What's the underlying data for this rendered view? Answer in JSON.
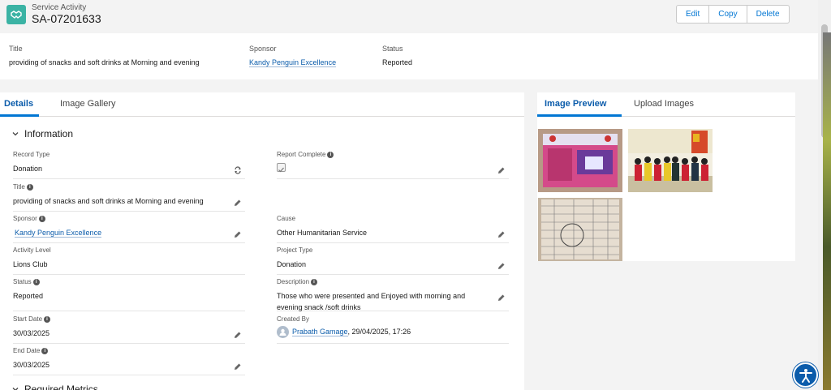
{
  "header": {
    "object_type": "Service Activity",
    "record_name": "SA-07201633",
    "buttons": {
      "edit": "Edit",
      "copy": "Copy",
      "delete": "Delete"
    }
  },
  "highlights": {
    "title_label": "Title",
    "title_value": "providing of snacks and soft drinks at Morning and evening",
    "sponsor_label": "Sponsor",
    "sponsor_value": "Kandy Penguin Excellence",
    "status_label": "Status",
    "status_value": "Reported"
  },
  "tabs": {
    "details": "Details",
    "image_gallery": "Image Gallery"
  },
  "section": {
    "information": "Information",
    "required_metrics": "Required Metrics"
  },
  "fields": {
    "record_type": {
      "label": "Record Type",
      "value": "Donation"
    },
    "report_complete": {
      "label": "Report Complete",
      "checked": true
    },
    "title": {
      "label": "Title",
      "value": "providing of snacks and soft drinks at Morning and evening"
    },
    "sponsor": {
      "label": "Sponsor",
      "value": "Kandy Penguin Excellence"
    },
    "cause": {
      "label": "Cause",
      "value": "Other Humanitarian Service"
    },
    "activity_level": {
      "label": "Activity Level",
      "value": "Lions Club"
    },
    "project_type": {
      "label": "Project Type",
      "value": "Donation"
    },
    "status": {
      "label": "Status",
      "value": "Reported"
    },
    "description": {
      "label": "Description",
      "value": "Those who were presented and Enjoyed with morning and evening snack /soft drinks"
    },
    "start_date": {
      "label": "Start Date",
      "value": "30/03/2025"
    },
    "created_by": {
      "label": "Created By",
      "user": "Prabath Gamage",
      "timestamp": ", 29/04/2025, 17:26"
    },
    "end_date": {
      "label": "End Date",
      "value": "30/03/2025"
    }
  },
  "side_tabs": {
    "image_preview": "Image Preview",
    "upload_images": "Upload Images"
  },
  "colors": {
    "brand": "#0176d3",
    "object_icon": "#3bb3a4",
    "link": "#0b5cab"
  },
  "icons": [
    "handshake-icon",
    "chevron-down-icon",
    "info-icon",
    "pencil-icon",
    "change-record-type-icon",
    "user-avatar-icon",
    "accessibility-icon"
  ]
}
